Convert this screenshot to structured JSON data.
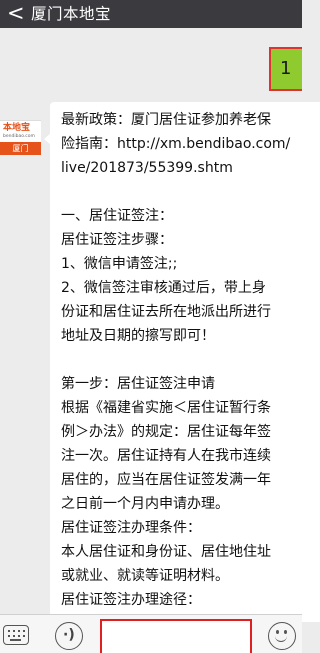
{
  "header": {
    "back_glyph": "<",
    "title": "厦门本地宝"
  },
  "self_avatar": {
    "label": "1",
    "color": "#8fcb2f"
  },
  "sender": {
    "logo_text": "本地宝",
    "logo_domain": "bendibao.com",
    "city": "厦门",
    "brand_color": "#e5531a"
  },
  "message": {
    "lines": [
      "最新政策：厦门居住证参加养老保",
      "险指南：http://xm.bendibao.com/",
      "live/201873/55399.shtm",
      "",
      "一、居住证签注：",
      "居住证签注步骤：",
      "1、微信申请签注;;",
      "2、微信签注审核通过后，带上身",
      "份证和居住证去所在地派出所进行",
      "地址及日期的擦写即可！",
      "",
      "第一步：居住证签注申请",
      "根据《福建省实施＜居住证暂行条",
      "例＞办法》的规定：居住证每年签",
      "注一次。居住证持有人在我市连续",
      "居住的，应当在居住证签发满一年",
      "之日前一个月内申请办理。",
      "居住证签注办理条件：",
      "本人居住证和身份证、居住地住址",
      "或就业、就读等证明材料。",
      "居住证签注办理途径："
    ]
  },
  "input_bar": {
    "voice_icon": "voice-icon",
    "keyboard_icon": "keyboard-menu-icon",
    "emoji_icon": "emoji-icon",
    "voice_glyph": "·)",
    "text_value": ""
  }
}
